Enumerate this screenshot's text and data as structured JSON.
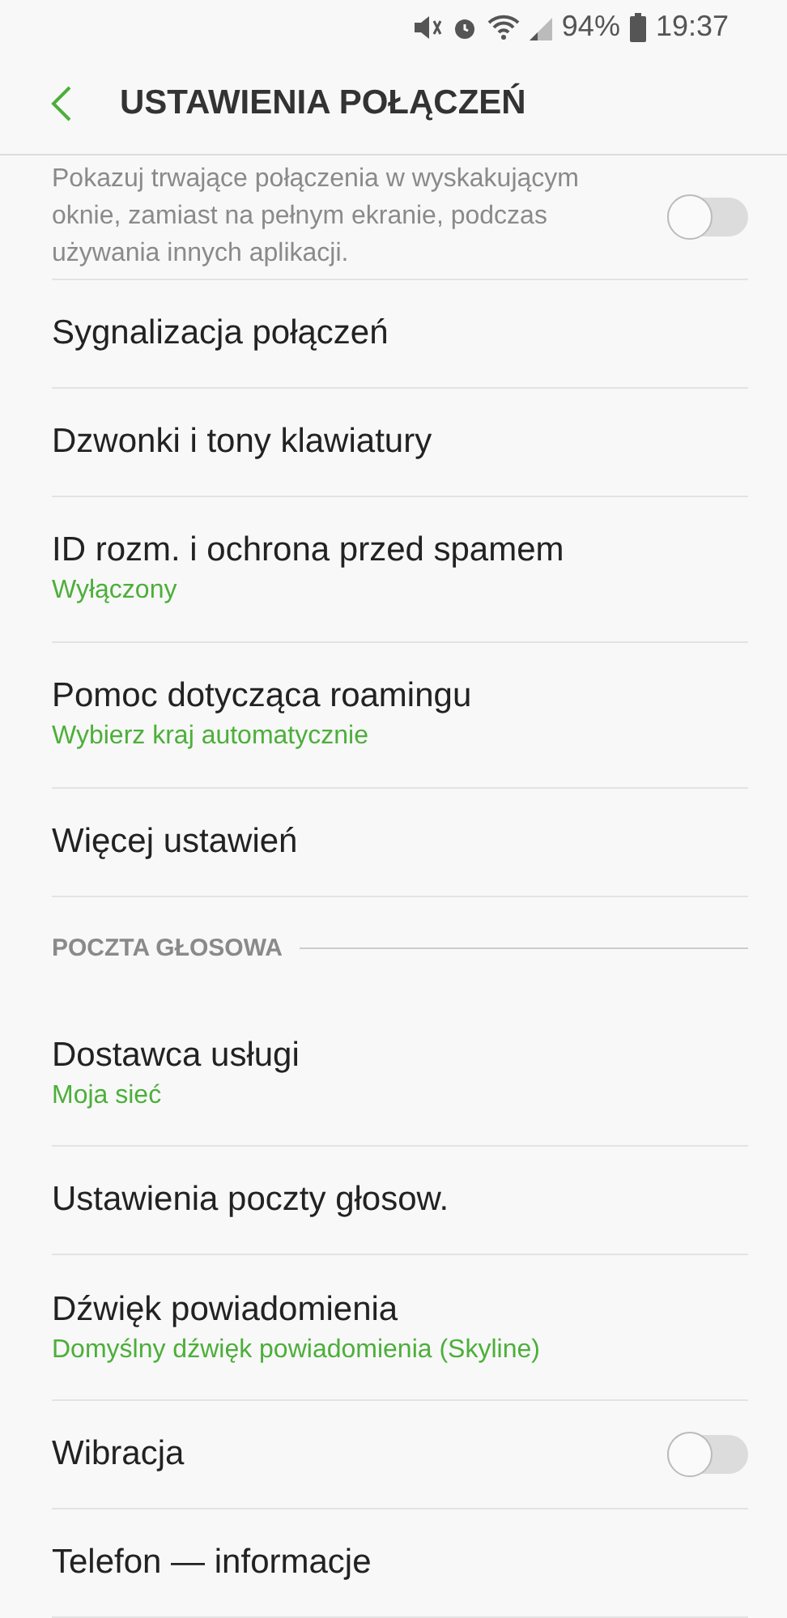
{
  "status_bar": {
    "battery": "94%",
    "time": "19:37"
  },
  "header": {
    "title": "USTAWIENIA POŁĄCZEŃ"
  },
  "items": [
    {
      "kind": "description",
      "text": "Pokazuj trwające połączenia w wyskakującym oknie, zamiast na pełnym ekranie, podczas używania innych aplikacji.",
      "toggle_on": false
    },
    {
      "kind": "item",
      "title": "Sygnalizacja połączeń"
    },
    {
      "kind": "item",
      "title": "Dzwonki i tony klawiatury"
    },
    {
      "kind": "item",
      "title": "ID rozm. i ochrona przed spamem",
      "subtitle": "Wyłączony"
    },
    {
      "kind": "item",
      "title": "Pomoc dotycząca roamingu",
      "subtitle": "Wybierz kraj automatycznie"
    },
    {
      "kind": "item",
      "title": "Więcej ustawień"
    },
    {
      "kind": "section",
      "title": "POCZTA GŁOSOWA"
    },
    {
      "kind": "item",
      "title": "Dostawca usługi",
      "subtitle": "Moja sieć"
    },
    {
      "kind": "item",
      "title": "Ustawienia poczty głosow."
    },
    {
      "kind": "item",
      "title": "Dźwięk powiadomienia",
      "subtitle": "Domyślny dźwięk powiadomienia (Skyline)"
    },
    {
      "kind": "toggle",
      "title": "Wibracja",
      "toggle_on": false
    },
    {
      "kind": "item",
      "title": "Telefon — informacje"
    }
  ]
}
